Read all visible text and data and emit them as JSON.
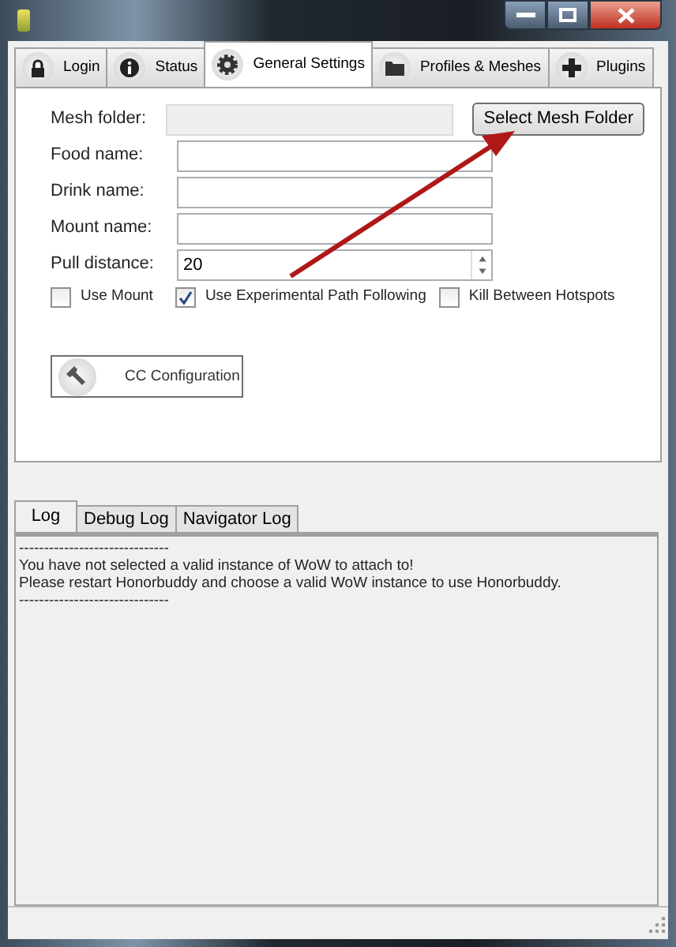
{
  "tabs": [
    {
      "label": "Login",
      "selected": false
    },
    {
      "label": "Status",
      "selected": false
    },
    {
      "label": "General Settings",
      "selected": true
    },
    {
      "label": "Profiles & Meshes",
      "selected": false
    },
    {
      "label": "Plugins",
      "selected": false
    }
  ],
  "fields": [
    {
      "kind": "text",
      "label": "Mesh folder:",
      "disabled": true,
      "button": "Select Mesh Folder"
    },
    {
      "kind": "text",
      "label": "Food name:",
      "disabled": false
    },
    {
      "kind": "text",
      "label": "Drink name:",
      "disabled": false
    },
    {
      "kind": "text",
      "label": "Mount name:",
      "disabled": false
    },
    {
      "kind": "number",
      "label": "Pull distance:",
      "value": "20",
      "disabled": false
    }
  ],
  "checkboxes": [
    {
      "label": "Use Mount",
      "checked": false
    },
    {
      "label": "Use Experimental Path Following",
      "checked": true
    },
    {
      "label": "Kill Between Hotspots",
      "checked": false
    }
  ],
  "cc_button": "CC Configuration",
  "log_tabs": [
    {
      "label": "Log",
      "selected": true
    },
    {
      "label": "Debug Log",
      "selected": false
    },
    {
      "label": "Navigator Log",
      "selected": false
    }
  ],
  "log_lines": [
    "------------------------------",
    "You have not selected a valid instance of WoW to attach to!",
    "Please restart Honorbuddy and choose a valid WoW instance to use Honorbuddy.",
    "------------------------------"
  ]
}
